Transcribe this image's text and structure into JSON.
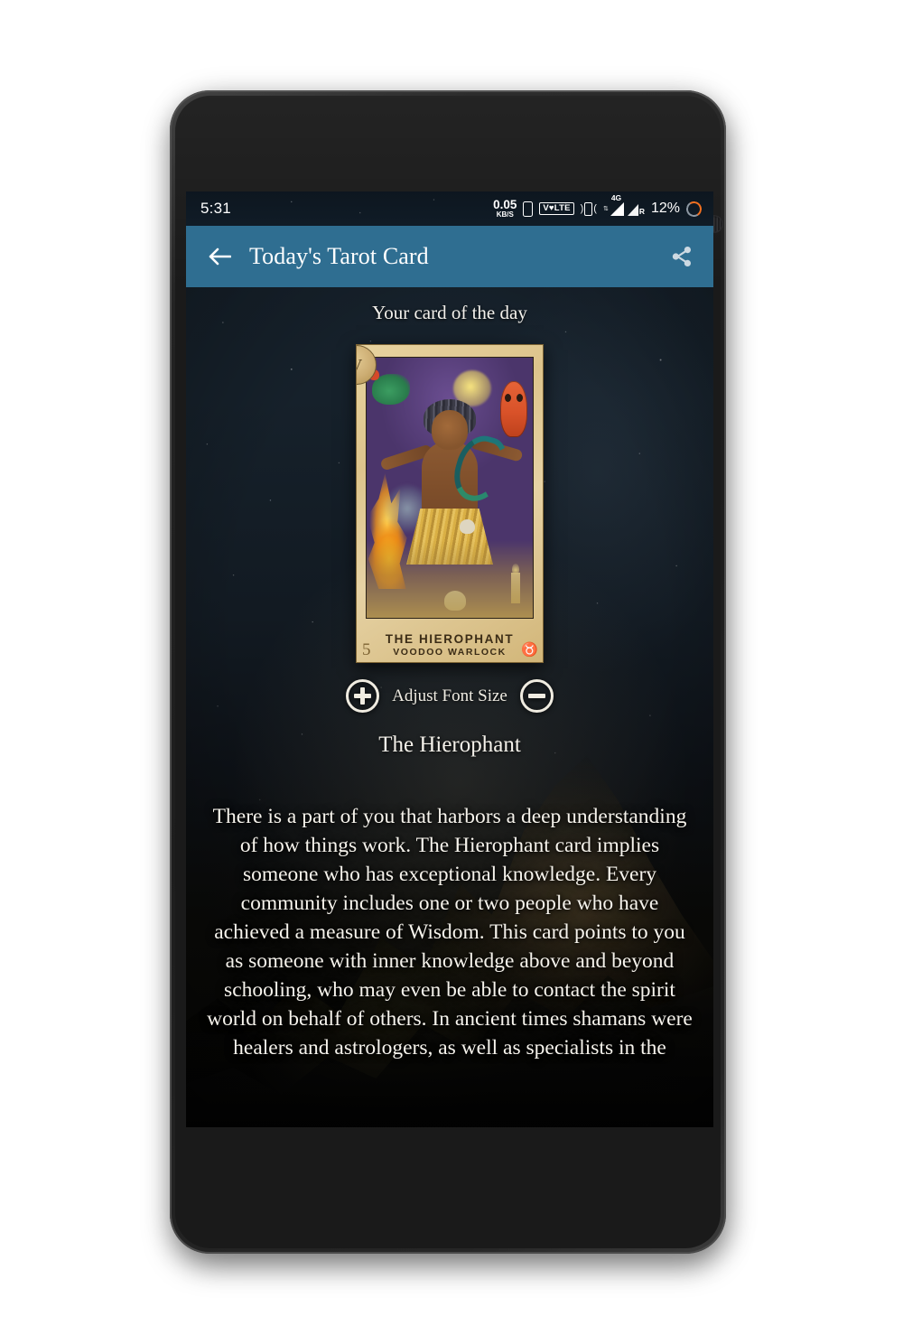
{
  "statusbar": {
    "time": "5:31",
    "netspeed_value": "0.05",
    "netspeed_unit": "KB/S",
    "sim_icon": "sim-card-icon",
    "volte_label": "V♥LTE",
    "vibrate_icon": "vibrate-icon",
    "network_type": "4G",
    "roaming_label": "R",
    "battery_percent": "12%",
    "battery_icon": "battery-ring-icon"
  },
  "appbar": {
    "back_icon": "arrow-left-icon",
    "title": "Today's Tarot Card",
    "share_icon": "share-icon",
    "background_color": "#2f6e91"
  },
  "content": {
    "subtitle": "Your card of the day",
    "card": {
      "numeral": "V",
      "name_line1": "THE HIEROPHANT",
      "name_line2": "VOODOO WARLOCK",
      "number": "5",
      "zodiac_symbol": "♉"
    },
    "font_controls": {
      "increase_icon": "plus-circle-icon",
      "label": "Adjust Font Size",
      "decrease_icon": "minus-circle-icon"
    },
    "card_title": "The Hierophant",
    "description": "There is a part of you that harbors a deep understanding of how things work.\nThe Hierophant card implies someone who has exceptional knowledge. Every community includes one or two people who have achieved a measure of Wisdom. This card points to you as someone with inner knowledge above and beyond schooling, who may even be able to contact the spirit world on behalf of others.\nIn ancient times shamans were healers and astrologers, as well as specialists in the"
  }
}
